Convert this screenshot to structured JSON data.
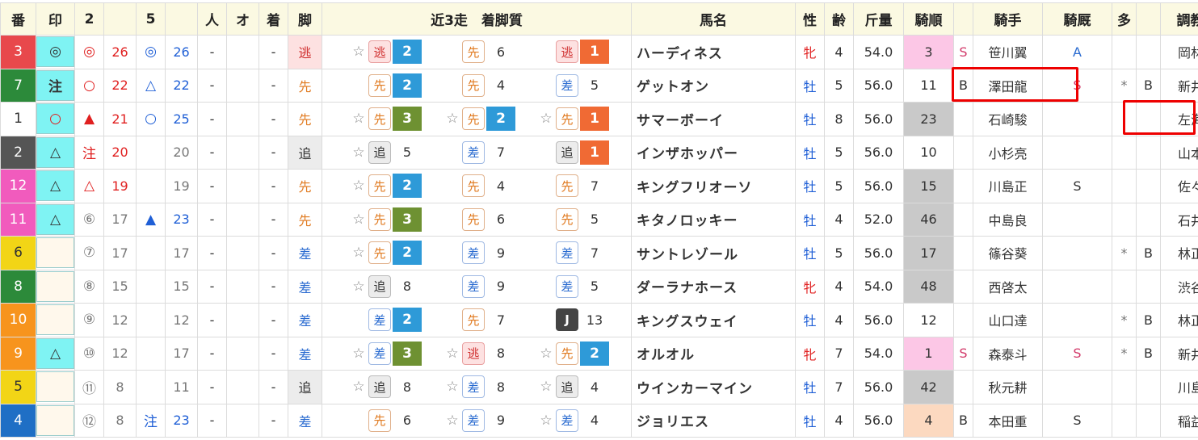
{
  "headers": {
    "ban": "番",
    "in": "印",
    "c2": "2",
    "c5": "5",
    "hito": "人",
    "o": "オ",
    "chaku": "着",
    "kyaku": "脚",
    "recent": "近3走　着脚質",
    "name": "馬名",
    "sex": "性",
    "age": "齢",
    "weight": "斤量",
    "jorder": "騎順",
    "jockey": "騎手",
    "jfav": "騎厩",
    "many": "多",
    "trainer": "調教師"
  },
  "rows": [
    {
      "ban": "3",
      "banColor": "#e8484c",
      "mark": "◎",
      "markColor": "#333",
      "markBg": "#7ff3f3",
      "s2": "◎",
      "s2Color": "red",
      "n2": "26",
      "s5": "◎",
      "s5Color": "blue",
      "n5": "26",
      "hito": "-",
      "o": "",
      "chaku": "-",
      "kyaku": "逃",
      "kyakuType": "nige",
      "races": [
        {
          "star": "☆",
          "k": "逃",
          "kt": "nige",
          "r": "2",
          "rc": "r2"
        },
        {
          "star": "",
          "k": "先",
          "kt": "senko",
          "r": "6",
          "rc": ""
        },
        {
          "star": "",
          "k": "逃",
          "kt": "nige",
          "r": "1",
          "rc": "r1"
        }
      ],
      "name": "ハーディネス",
      "sex": "牝",
      "age": "4",
      "weight": "54.0",
      "jorder": "3",
      "jorderBg": "pink",
      "jmark": "S",
      "jockey": "笹川翼",
      "jfav": "A",
      "jfavColor": "s-blue",
      "many": "",
      "b": "",
      "trainer": "岡林光"
    },
    {
      "ban": "7",
      "banColor": "#2c8a3a",
      "mark": "注",
      "markColor": "#333",
      "markBg": "#7ff3f3",
      "s2": "○",
      "s2Color": "red",
      "n2": "22",
      "s5": "△",
      "s5Color": "blue",
      "n5": "22",
      "hito": "-",
      "o": "",
      "chaku": "-",
      "kyaku": "先",
      "kyakuType": "senko",
      "races": [
        {
          "star": "",
          "k": "先",
          "kt": "senko",
          "r": "2",
          "rc": "r2"
        },
        {
          "star": "",
          "k": "先",
          "kt": "senko",
          "r": "4",
          "rc": ""
        },
        {
          "star": "",
          "k": "差",
          "kt": "sashi",
          "r": "5",
          "rc": ""
        }
      ],
      "name": "ゲットオン",
      "sex": "牡",
      "age": "5",
      "weight": "56.0",
      "jorder": "11",
      "jorderBg": "",
      "jmark": "B",
      "jockey": "澤田龍",
      "jfav": "S",
      "jfavColor": "s-red",
      "many": "*",
      "b": "B",
      "trainer": "新井清"
    },
    {
      "ban": "1",
      "banColor": "#ffffff",
      "mark": "○",
      "markColor": "#e02020",
      "markBg": "#7ff3f3",
      "s2": "▲",
      "s2Color": "red",
      "n2": "21",
      "s5": "○",
      "s5Color": "blue",
      "n5": "25",
      "hito": "-",
      "o": "",
      "chaku": "-",
      "kyaku": "先",
      "kyakuType": "senko",
      "races": [
        {
          "star": "☆",
          "k": "先",
          "kt": "senko",
          "r": "3",
          "rc": "r3"
        },
        {
          "star": "☆",
          "k": "先",
          "kt": "senko",
          "r": "2",
          "rc": "r2"
        },
        {
          "star": "☆",
          "k": "先",
          "kt": "senko",
          "r": "1",
          "rc": "r1"
        }
      ],
      "name": "サマーボーイ",
      "sex": "牡",
      "age": "8",
      "weight": "56.0",
      "jorder": "23",
      "jorderBg": "gray",
      "jmark": "",
      "jockey": "石崎駿",
      "jfav": "",
      "jfavColor": "",
      "many": "",
      "b": "",
      "trainer": "左海誠"
    },
    {
      "ban": "2",
      "banColor": "#555555",
      "mark": "△",
      "markColor": "#333",
      "markBg": "#7ff3f3",
      "s2": "注",
      "s2Color": "red",
      "n2": "20",
      "s5": "",
      "s5Color": "grey",
      "n5": "20",
      "hito": "-",
      "o": "",
      "chaku": "-",
      "kyaku": "追",
      "kyakuType": "oi",
      "races": [
        {
          "star": "☆",
          "k": "追",
          "kt": "oi",
          "r": "5",
          "rc": ""
        },
        {
          "star": "",
          "k": "差",
          "kt": "sashi",
          "r": "7",
          "rc": ""
        },
        {
          "star": "",
          "k": "追",
          "kt": "oi",
          "r": "1",
          "rc": "r1"
        }
      ],
      "name": "インザホッパー",
      "sex": "牡",
      "age": "5",
      "weight": "56.0",
      "jorder": "10",
      "jorderBg": "",
      "jmark": "",
      "jockey": "小杉亮",
      "jfav": "",
      "jfavColor": "",
      "many": "",
      "b": "",
      "trainer": "山本学"
    },
    {
      "ban": "12",
      "banColor": "#f15bbd",
      "mark": "△",
      "markColor": "#333",
      "markBg": "#7ff3f3",
      "s2": "△",
      "s2Color": "red",
      "n2": "19",
      "s5": "",
      "s5Color": "grey",
      "n5": "19",
      "hito": "-",
      "o": "",
      "chaku": "-",
      "kyaku": "先",
      "kyakuType": "senko",
      "races": [
        {
          "star": "☆",
          "k": "先",
          "kt": "senko",
          "r": "2",
          "rc": "r2"
        },
        {
          "star": "",
          "k": "先",
          "kt": "senko",
          "r": "4",
          "rc": ""
        },
        {
          "star": "",
          "k": "先",
          "kt": "senko",
          "r": "7",
          "rc": ""
        }
      ],
      "name": "キングフリオーソ",
      "sex": "牡",
      "age": "5",
      "weight": "56.0",
      "jorder": "15",
      "jorderBg": "gray",
      "jmark": "",
      "jockey": "川島正",
      "jfav": "S",
      "jfavColor": "dark",
      "many": "",
      "b": "",
      "trainer": "佐々功"
    },
    {
      "ban": "11",
      "banColor": "#f15bbd",
      "mark": "△",
      "markColor": "#333",
      "markBg": "#7ff3f3",
      "s2": "⑥",
      "s2Color": "grey",
      "n2": "17",
      "s5": "▲",
      "s5Color": "blue",
      "n5": "23",
      "hito": "-",
      "o": "",
      "chaku": "-",
      "kyaku": "先",
      "kyakuType": "senko",
      "races": [
        {
          "star": "☆",
          "k": "先",
          "kt": "senko",
          "r": "3",
          "rc": "r3"
        },
        {
          "star": "",
          "k": "先",
          "kt": "senko",
          "r": "6",
          "rc": ""
        },
        {
          "star": "",
          "k": "先",
          "kt": "senko",
          "r": "5",
          "rc": ""
        }
      ],
      "name": "キタノロッキー",
      "sex": "牡",
      "age": "4",
      "weight": "52.0",
      "jorder": "46",
      "jorderBg": "gray",
      "jmark": "",
      "jockey": "中島良",
      "jfav": "",
      "jfavColor": "",
      "many": "",
      "b": "",
      "trainer": "石井勝"
    },
    {
      "ban": "6",
      "banColor": "#f2d516",
      "mark": "",
      "markColor": "#333",
      "markBg": "#fff8ec",
      "s2": "⑦",
      "s2Color": "grey",
      "n2": "17",
      "s5": "",
      "s5Color": "grey",
      "n5": "17",
      "hito": "-",
      "o": "",
      "chaku": "-",
      "kyaku": "差",
      "kyakuType": "sashi",
      "races": [
        {
          "star": "☆",
          "k": "先",
          "kt": "senko",
          "r": "2",
          "rc": "r2"
        },
        {
          "star": "",
          "k": "差",
          "kt": "sashi",
          "r": "9",
          "rc": ""
        },
        {
          "star": "",
          "k": "差",
          "kt": "sashi",
          "r": "7",
          "rc": ""
        }
      ],
      "name": "サントレゾール",
      "sex": "牡",
      "age": "5",
      "weight": "56.0",
      "jorder": "17",
      "jorderBg": "gray",
      "jmark": "",
      "jockey": "篠谷葵",
      "jfav": "",
      "jfavColor": "",
      "many": "*",
      "b": "B",
      "trainer": "林正人"
    },
    {
      "ban": "8",
      "banColor": "#2c8a3a",
      "mark": "",
      "markColor": "#333",
      "markBg": "#fff8ec",
      "s2": "⑧",
      "s2Color": "grey",
      "n2": "15",
      "s5": "",
      "s5Color": "grey",
      "n5": "15",
      "hito": "-",
      "o": "",
      "chaku": "-",
      "kyaku": "差",
      "kyakuType": "sashi",
      "races": [
        {
          "star": "☆",
          "k": "追",
          "kt": "oi",
          "r": "8",
          "rc": ""
        },
        {
          "star": "",
          "k": "差",
          "kt": "sashi",
          "r": "9",
          "rc": ""
        },
        {
          "star": "",
          "k": "差",
          "kt": "sashi",
          "r": "5",
          "rc": ""
        }
      ],
      "name": "ダーラナホース",
      "sex": "牝",
      "age": "4",
      "weight": "54.0",
      "jorder": "48",
      "jorderBg": "gray",
      "jmark": "",
      "jockey": "西啓太",
      "jfav": "",
      "jfavColor": "",
      "many": "",
      "b": "",
      "trainer": "渋谷博"
    },
    {
      "ban": "10",
      "banColor": "#f7941d",
      "mark": "",
      "markColor": "#333",
      "markBg": "#fff8ec",
      "s2": "⑨",
      "s2Color": "grey",
      "n2": "12",
      "s5": "",
      "s5Color": "grey",
      "n5": "12",
      "hito": "-",
      "o": "",
      "chaku": "-",
      "kyaku": "差",
      "kyakuType": "sashi",
      "races": [
        {
          "star": "",
          "k": "差",
          "kt": "sashi",
          "r": "2",
          "rc": "r2"
        },
        {
          "star": "",
          "k": "先",
          "kt": "senko",
          "r": "7",
          "rc": ""
        },
        {
          "star": "",
          "k": "J",
          "kt": "jump",
          "r": "13",
          "rc": ""
        }
      ],
      "name": "キングスウェイ",
      "sex": "牡",
      "age": "4",
      "weight": "56.0",
      "jorder": "12",
      "jorderBg": "",
      "jmark": "",
      "jockey": "山口達",
      "jfav": "",
      "jfavColor": "",
      "many": "*",
      "b": "B",
      "trainer": "林正人"
    },
    {
      "ban": "9",
      "banColor": "#f7941d",
      "mark": "△",
      "markColor": "#333",
      "markBg": "#7ff3f3",
      "s2": "⑩",
      "s2Color": "grey",
      "n2": "12",
      "s5": "",
      "s5Color": "grey",
      "n5": "17",
      "hito": "-",
      "o": "",
      "chaku": "-",
      "kyaku": "差",
      "kyakuType": "sashi",
      "races": [
        {
          "star": "☆",
          "k": "差",
          "kt": "sashi",
          "r": "3",
          "rc": "r3"
        },
        {
          "star": "☆",
          "k": "逃",
          "kt": "nige",
          "r": "8",
          "rc": ""
        },
        {
          "star": "☆",
          "k": "先",
          "kt": "senko",
          "r": "2",
          "rc": "r2"
        }
      ],
      "name": "オルオル",
      "sex": "牝",
      "age": "7",
      "weight": "54.0",
      "jorder": "1",
      "jorderBg": "pink",
      "jmark": "S",
      "jockey": "森泰斗",
      "jfav": "S",
      "jfavColor": "s-red",
      "many": "*",
      "b": "B",
      "trainer": "新井清"
    },
    {
      "ban": "5",
      "banColor": "#f2d516",
      "mark": "",
      "markColor": "#333",
      "markBg": "#fff8ec",
      "s2": "⑪",
      "s2Color": "grey",
      "n2": "8",
      "s5": "",
      "s5Color": "grey",
      "n5": "11",
      "hito": "-",
      "o": "",
      "chaku": "-",
      "kyaku": "追",
      "kyakuType": "oi",
      "races": [
        {
          "star": "☆",
          "k": "追",
          "kt": "oi",
          "r": "8",
          "rc": ""
        },
        {
          "star": "☆",
          "k": "差",
          "kt": "sashi",
          "r": "8",
          "rc": ""
        },
        {
          "star": "☆",
          "k": "追",
          "kt": "oi",
          "r": "4",
          "rc": ""
        }
      ],
      "name": "ウインカーマイン",
      "sex": "牡",
      "age": "7",
      "weight": "56.0",
      "jorder": "42",
      "jorderBg": "gray",
      "jmark": "",
      "jockey": "秋元耕",
      "jfav": "",
      "jfavColor": "",
      "many": "",
      "b": "",
      "trainer": "川島豊"
    },
    {
      "ban": "4",
      "banColor": "#1f6fc5",
      "mark": "",
      "markColor": "#333",
      "markBg": "#fff8ec",
      "s2": "⑫",
      "s2Color": "grey",
      "n2": "8",
      "s5": "注",
      "s5Color": "blue",
      "n5": "23",
      "hito": "-",
      "o": "",
      "chaku": "-",
      "kyaku": "差",
      "kyakuType": "sashi",
      "races": [
        {
          "star": "",
          "k": "先",
          "kt": "senko",
          "r": "6",
          "rc": ""
        },
        {
          "star": "☆",
          "k": "差",
          "kt": "sashi",
          "r": "9",
          "rc": ""
        },
        {
          "star": "☆",
          "k": "差",
          "kt": "sashi",
          "r": "4",
          "rc": ""
        }
      ],
      "name": "ジョリエス",
      "sex": "牡",
      "age": "4",
      "weight": "56.0",
      "jorder": "4",
      "jorderBg": "peach",
      "jmark": "B",
      "jockey": "本田重",
      "jfav": "S",
      "jfavColor": "dark",
      "many": "",
      "b": "",
      "trainer": "稲益貴"
    }
  ]
}
